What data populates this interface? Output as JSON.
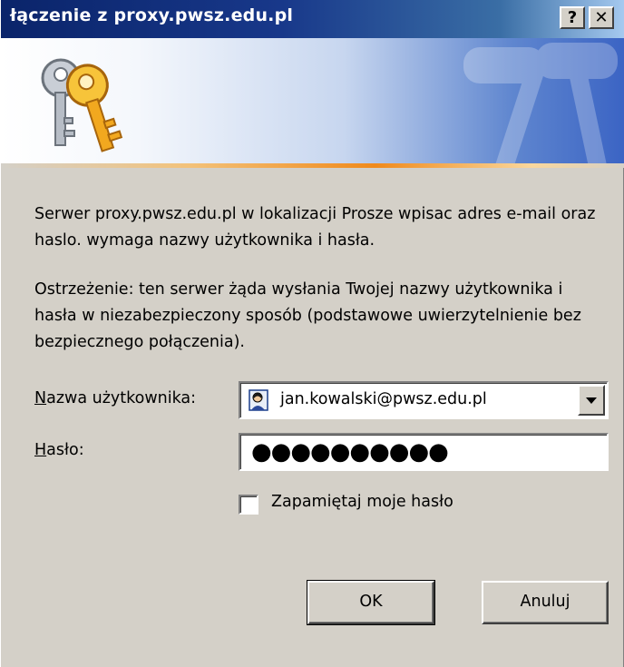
{
  "window": {
    "title": "łączenie z proxy.pwsz.edu.pl",
    "help_label": "?",
    "close_label": "✕"
  },
  "banner": {
    "icon": "keys-icon"
  },
  "message": {
    "line1": "Serwer proxy.pwsz.edu.pl w lokalizacji Prosze wpisac adres e-mail oraz haslo. wymaga nazwy użytkownika i hasła.",
    "line2": "Ostrzeżenie: ten serwer żąda wysłania Twojej nazwy użytkownika i hasła w niezabezpieczony sposób (podstawowe uwierzytelnienie bez bezpiecznego połączenia)."
  },
  "form": {
    "username_label_first": "N",
    "username_label_rest": "azwa użytkownika:",
    "username_value": "jan.kowalski@pwsz.edu.pl",
    "password_label_first": "H",
    "password_label_rest": "asło:",
    "password_value": "●●●●●●●●●●",
    "remember_label": "Zapamiętaj moje hasło",
    "remember_checked": false
  },
  "buttons": {
    "ok": "OK",
    "cancel": "Anuluj"
  },
  "colors": {
    "titlebar": "#0a246a",
    "accent_stripe": "#f08a1c",
    "dialog_bg": "#d4d0c8"
  }
}
